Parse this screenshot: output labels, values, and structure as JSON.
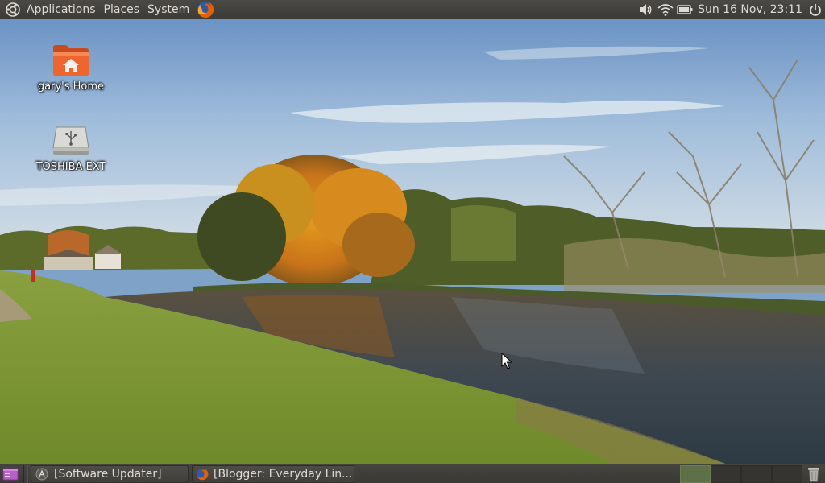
{
  "top_panel": {
    "menus": [
      {
        "label": "Applications"
      },
      {
        "label": "Places"
      },
      {
        "label": "System"
      }
    ],
    "icons": {
      "logo": "ubuntu-logo-icon",
      "launcher": "firefox-icon",
      "volume": "volume-icon",
      "network": "wifi-icon",
      "battery": "battery-icon",
      "power": "power-icon"
    },
    "clock": "Sun 16 Nov, 23:11"
  },
  "desktop": {
    "icons": [
      {
        "label": "gary's Home",
        "icon": "home-folder-icon"
      },
      {
        "label": "TOSHIBA EXT",
        "icon": "usb-drive-icon"
      }
    ],
    "wallpaper": "river-autumn-landscape"
  },
  "bottom_panel": {
    "show_desktop_icon": "show-desktop-icon",
    "tasks": [
      {
        "label": "[Software Updater]",
        "icon": "software-updater-icon"
      },
      {
        "label": "[Blogger: Everyday Lin...",
        "icon": "firefox-icon"
      }
    ],
    "workspaces": [
      {
        "active": true
      },
      {
        "active": false
      },
      {
        "active": false
      },
      {
        "active": false
      }
    ],
    "trash_icon": "trash-icon"
  },
  "colors": {
    "panel": "#3c3b37",
    "panel_text": "#dfdbd2",
    "home_folder": "#e8592a",
    "active_workspace": "#5e7048"
  }
}
